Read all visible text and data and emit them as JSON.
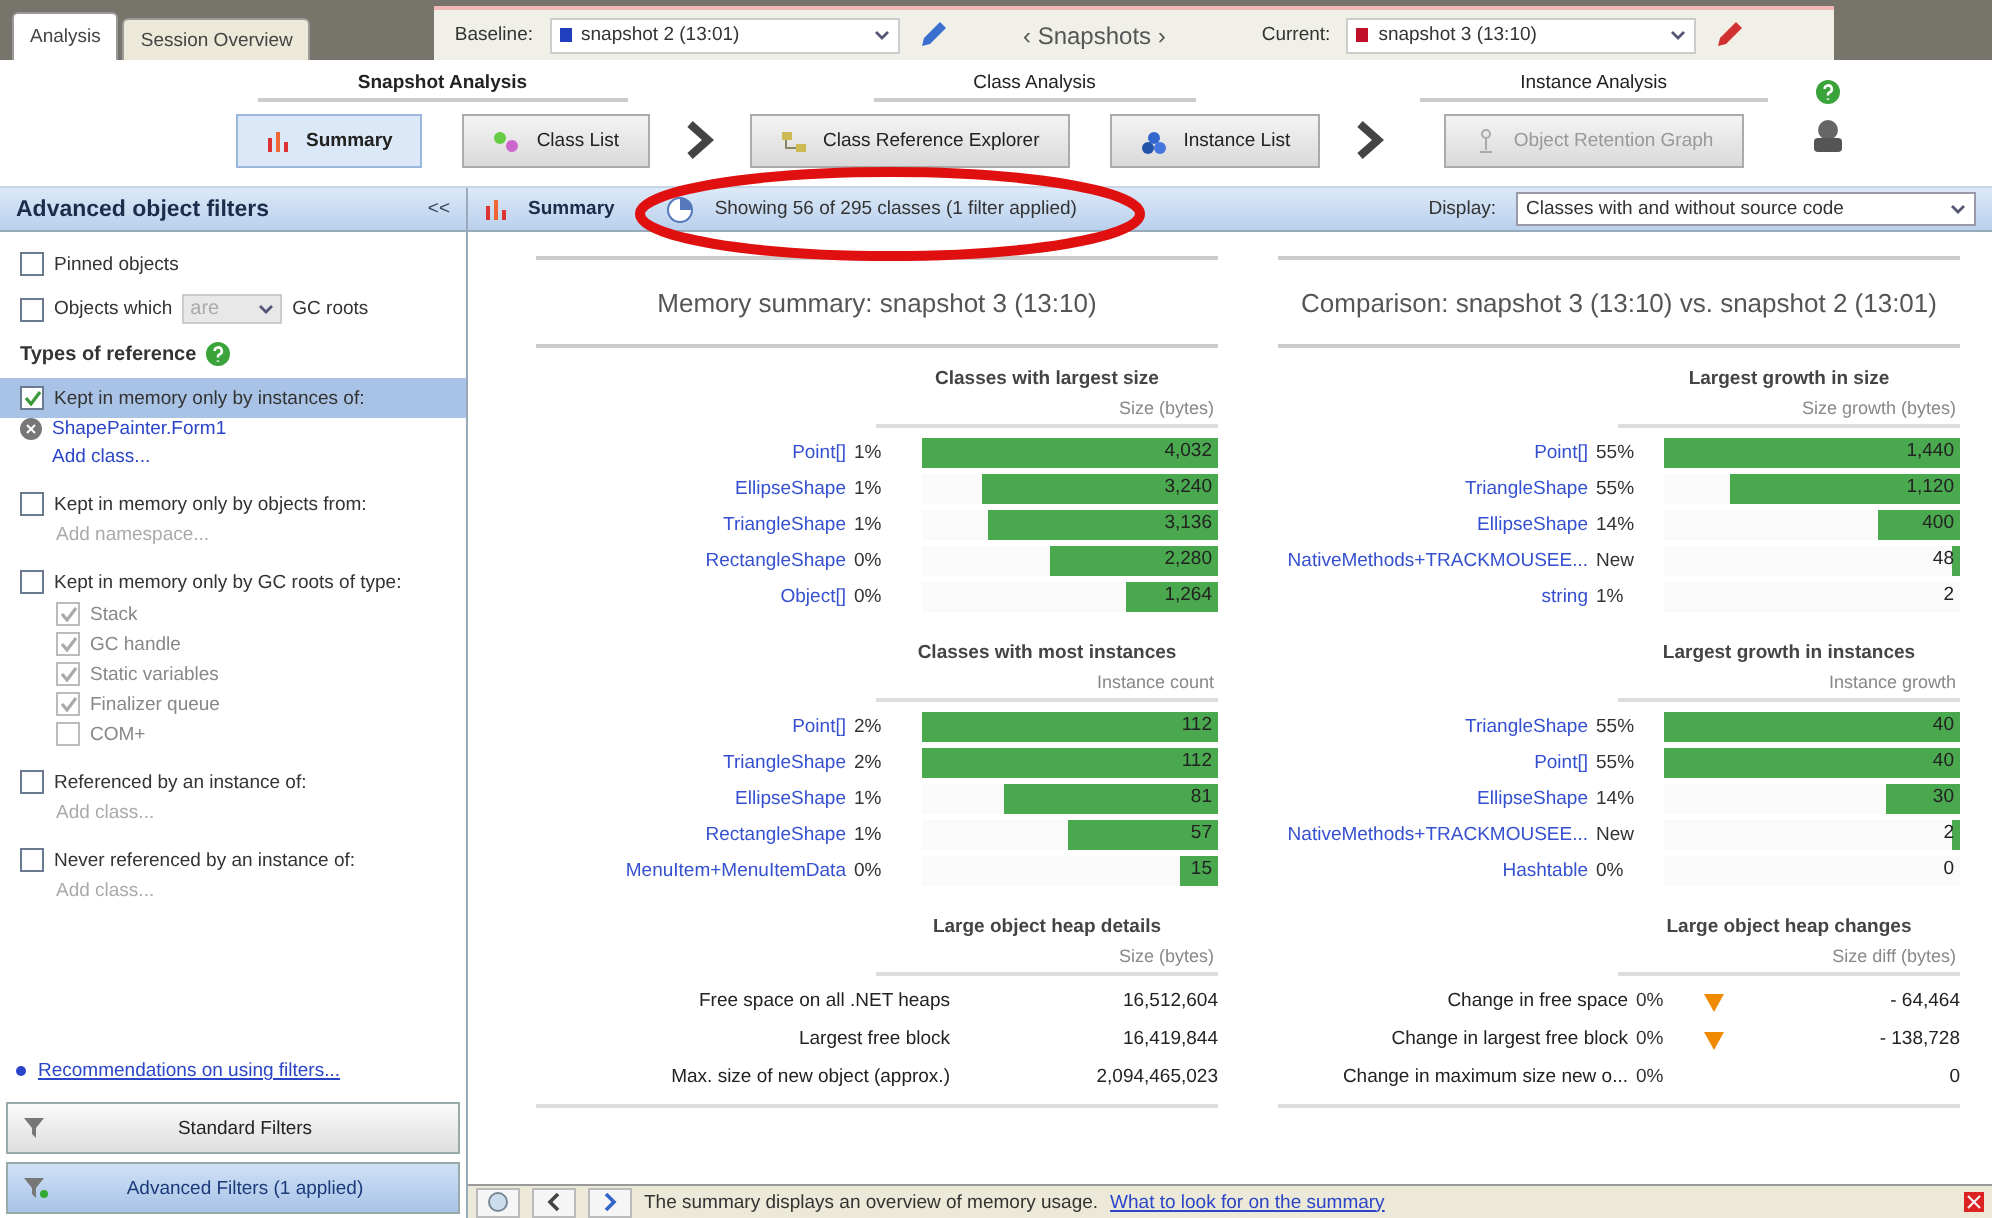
{
  "tabs": [
    {
      "label": "Analysis",
      "selected": true
    },
    {
      "label": "Session Overview",
      "selected": false
    }
  ],
  "snapshots": {
    "baseline": {
      "label": "Baseline:",
      "value": "snapshot 2 (13:01)",
      "color": "#1f3fbf"
    },
    "nav": "‹ Snapshots ›",
    "current": {
      "label": "Current:",
      "value": "snapshot 3 (13:10)",
      "color": "#c0102a"
    }
  },
  "toolbar": [
    {
      "title": "Snapshot Analysis",
      "buttons": [
        {
          "label": "Summary",
          "selected": true,
          "disabled": false
        },
        {
          "label": "Class List",
          "selected": false,
          "disabled": false
        }
      ]
    },
    {
      "title": "Class Analysis",
      "buttons": [
        {
          "label": "Class Reference Explorer",
          "selected": false,
          "disabled": false
        },
        {
          "label": "Instance List",
          "selected": false,
          "disabled": false
        }
      ]
    },
    {
      "title": "Instance Analysis",
      "buttons": [
        {
          "label": "Object Retention Graph",
          "selected": false,
          "disabled": true
        }
      ]
    }
  ],
  "sidebar": {
    "title": "Advanced object filters",
    "collapse": "<<",
    "filters": [
      {
        "kind": "checkbox",
        "label": "Pinned objects",
        "checked": false,
        "selected": false
      },
      {
        "kind": "combo",
        "prefix": "Objects which",
        "value": "are",
        "disabled": true,
        "suffix": "GC roots",
        "checked": false,
        "selected": false
      },
      {
        "kind": "heading",
        "label": "Types of reference"
      },
      {
        "kind": "checkbox",
        "label": "Kept in memory only by instances of:",
        "checked": true,
        "selected": true,
        "classes": [
          "ShapePainter.Form1"
        ],
        "add": {
          "label": "Add class...",
          "disabled": false
        }
      },
      {
        "kind": "checkbox",
        "label": "Kept in memory only by objects from:",
        "checked": false,
        "selected": false,
        "add": {
          "label": "Add namespace...",
          "disabled": true
        }
      },
      {
        "kind": "checkbox",
        "label": "Kept in memory only by GC roots of type:",
        "checked": false,
        "selected": false,
        "roots": [
          {
            "label": "Stack",
            "checked": true
          },
          {
            "label": "GC handle",
            "checked": true
          },
          {
            "label": "Static variables",
            "checked": true
          },
          {
            "label": "Finalizer queue",
            "checked": true
          },
          {
            "label": "COM+",
            "checked": false
          }
        ]
      },
      {
        "kind": "checkbox",
        "label": "Referenced by an instance of:",
        "checked": false,
        "selected": false,
        "add": {
          "label": "Add class...",
          "disabled": true
        }
      },
      {
        "kind": "checkbox",
        "label": "Never referenced by an instance of:",
        "checked": false,
        "selected": false,
        "add": {
          "label": "Add class...",
          "disabled": true
        }
      }
    ],
    "link": "Recommendations on using filters...",
    "buttons": [
      {
        "label": "Standard Filters",
        "selected": false
      },
      {
        "label": "Advanced Filters (1 applied)",
        "selected": true
      }
    ]
  },
  "header": {
    "title": "Summary",
    "status": "Showing 56 of 295 classes (1 filter applied)",
    "display_label": "Display:",
    "display": "Classes with and without source code"
  },
  "columns": [
    {
      "title": "Memory summary: snapshot 3 (13:10)",
      "sections": [
        {
          "kind": "bars",
          "title": "Classes with largest size",
          "unit": "Size (bytes)",
          "rows": [
            {
              "name": "Point[]",
              "pct": "1%",
              "value": "4,032",
              "level": 1
            },
            {
              "name": "EllipseShape",
              "pct": "1%",
              "value": "3,240",
              "level": 0.8
            },
            {
              "name": "TriangleShape",
              "pct": "1%",
              "value": "3,136",
              "level": 0.78
            },
            {
              "name": "RectangleShape",
              "pct": "0%",
              "value": "2,280",
              "level": 0.57
            },
            {
              "name": "Object[]",
              "pct": "0%",
              "value": "1,264",
              "level": 0.31
            }
          ]
        },
        {
          "kind": "bars",
          "title": "Classes with most instances",
          "unit": "Instance count",
          "rows": [
            {
              "name": "Point[]",
              "pct": "2%",
              "value": "112",
              "level": 1
            },
            {
              "name": "TriangleShape",
              "pct": "2%",
              "value": "112",
              "level": 1
            },
            {
              "name": "EllipseShape",
              "pct": "1%",
              "value": "81",
              "level": 0.72
            },
            {
              "name": "RectangleShape",
              "pct": "1%",
              "value": "57",
              "level": 0.51
            },
            {
              "name": "MenuItem+MenuItemData",
              "pct": "0%",
              "value": "15",
              "level": 0.13
            }
          ]
        },
        {
          "kind": "details",
          "title": "Large object heap details",
          "unit": "Size (bytes)",
          "rows": [
            {
              "label": "Free space on all .NET heaps",
              "value": "16,512,604"
            },
            {
              "label": "Largest free block",
              "value": "16,419,844"
            },
            {
              "label": "Max. size of new object (approx.)",
              "value": "2,094,465,023"
            }
          ]
        }
      ]
    },
    {
      "title": "Comparison: snapshot 3 (13:10) vs. snapshot 2 (13:01)",
      "sections": [
        {
          "kind": "bars",
          "title": "Largest growth in size",
          "unit": "Size growth (bytes)",
          "rows": [
            {
              "name": "Point[]",
              "pct": "55%",
              "value": "1,440",
              "level": 1
            },
            {
              "name": "TriangleShape",
              "pct": "55%",
              "value": "1,120",
              "level": 0.78
            },
            {
              "name": "EllipseShape",
              "pct": "14%",
              "value": "400",
              "level": 0.28
            },
            {
              "name": "NativeMethods+TRACKMOUSEE...",
              "pct": "New",
              "value": "48",
              "level": 0.03
            },
            {
              "name": "string",
              "pct": "1%",
              "value": "2"
            }
          ]
        },
        {
          "kind": "bars",
          "title": "Largest growth in instances",
          "unit": "Instance growth",
          "rows": [
            {
              "name": "TriangleShape",
              "pct": "55%",
              "value": "40",
              "level": 1
            },
            {
              "name": "Point[]",
              "pct": "55%",
              "value": "40",
              "level": 1
            },
            {
              "name": "EllipseShape",
              "pct": "14%",
              "value": "30",
              "level": 0.25
            },
            {
              "name": "NativeMethods+TRACKMOUSEE...",
              "pct": "New",
              "value": "2",
              "level": 0.03
            },
            {
              "name": "Hashtable",
              "pct": "0%",
              "value": "0"
            }
          ]
        },
        {
          "kind": "details",
          "title": "Large object heap changes",
          "unit": "Size diff (bytes)",
          "rows": [
            {
              "label": "Change in free space",
              "pct": "0%",
              "value": "- 64,464",
              "decreasing": true
            },
            {
              "label": "Change in largest free block",
              "pct": "0%",
              "value": "- 138,728",
              "decreasing": true
            },
            {
              "label": "Change in maximum size new o...",
              "pct": "0%",
              "value": "0"
            }
          ]
        }
      ]
    }
  ],
  "status_bar": {
    "text": "The summary displays an overview of memory usage.",
    "link": "What to look for on the summary"
  }
}
